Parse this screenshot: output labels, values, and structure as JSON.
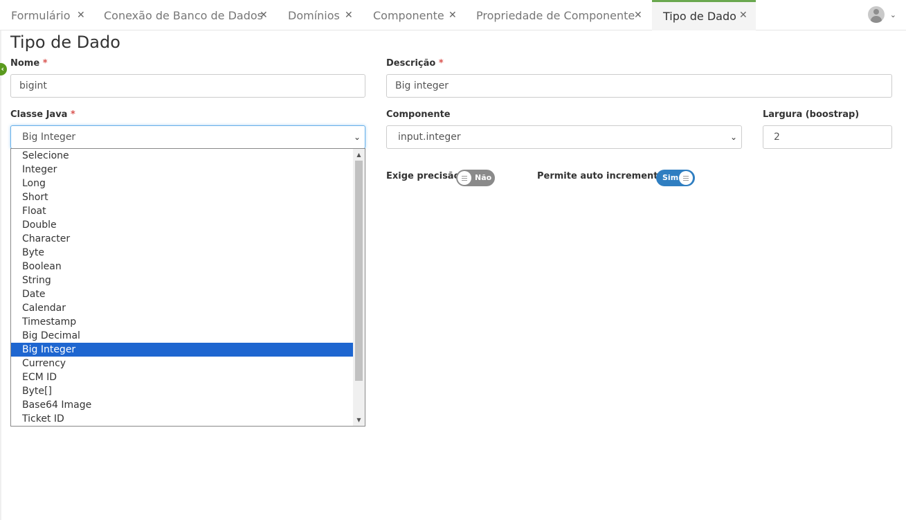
{
  "tabs": [
    {
      "label": "Formulário",
      "active": false
    },
    {
      "label": "Conexão de Banco de Dados",
      "active": false
    },
    {
      "label": "Domínios",
      "active": false
    },
    {
      "label": "Componente",
      "active": false
    },
    {
      "label": "Propriedade de Componente",
      "active": false
    },
    {
      "label": "Tipo de Dado",
      "active": true
    }
  ],
  "close_glyph": "✕",
  "page_title": "Tipo de Dado",
  "required_mark": "*",
  "form": {
    "nome": {
      "label": "Nome",
      "value": "bigint"
    },
    "descricao": {
      "label": "Descrição",
      "value": "Big integer"
    },
    "classe_java": {
      "label": "Classe Java",
      "value": "Big Integer"
    },
    "componente": {
      "label": "Componente",
      "value": "input.integer"
    },
    "largura": {
      "label": "Largura (boostrap)",
      "value": "2"
    },
    "exige_precisao": {
      "label": "Exige precisão",
      "state": "Não"
    },
    "permite_auto_incremento": {
      "label": "Permite auto incremento",
      "state": "Sim"
    }
  },
  "dropdown_options": [
    "Selecione",
    "Integer",
    "Long",
    "Short",
    "Float",
    "Double",
    "Character",
    "Byte",
    "Boolean",
    "String",
    "Date",
    "Calendar",
    "Timestamp",
    "Big Decimal",
    "Big Integer",
    "Currency",
    "ECM ID",
    "Byte[]",
    "Base64 Image",
    "Ticket ID"
  ],
  "dropdown_selected": "Big Integer",
  "colors": {
    "accent_green": "#6aa84f",
    "selected_blue": "#1e66d0",
    "toggle_on": "#2f7ec1",
    "toggle_off": "#8a8a8a",
    "required_red": "#d9534f"
  },
  "icons": {
    "user": "avatar-icon",
    "user_menu": "chevron-down-icon",
    "collapse": "chevron-left-icon",
    "select": "chevron-down-icon"
  }
}
